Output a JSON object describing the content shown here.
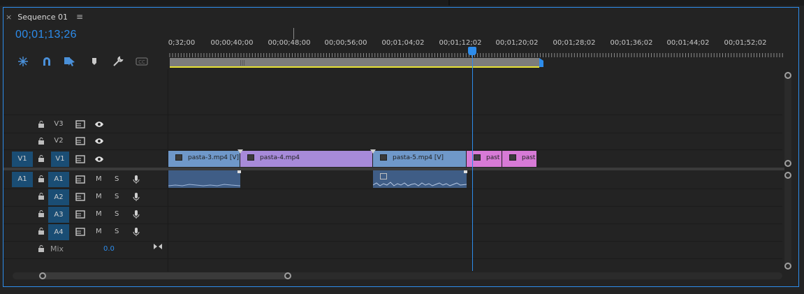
{
  "tab": {
    "title": "Sequence 01"
  },
  "timecode": "00;01;13;26",
  "ruler_labels": [
    "0;32;00",
    "00;00;40;00",
    "00;00;48;00",
    "00;00;56;00",
    "00;01;04;02",
    "00;01;12;02",
    "00;01;20;02",
    "00;01;28;02",
    "00;01;36;02",
    "00;01;44;02",
    "00;01;52;02"
  ],
  "toolbar": [
    "insert-snap-icon",
    "magnet-icon",
    "linked-selection-icon",
    "marker-icon",
    "wrench-icon",
    "captions-icon"
  ],
  "video_tracks": [
    {
      "name": "V3"
    },
    {
      "name": "V2"
    },
    {
      "name": "V1",
      "source": "V1"
    }
  ],
  "audio_tracks": [
    {
      "name": "A1",
      "source": "A1",
      "m": "M",
      "s": "S"
    },
    {
      "name": "A2",
      "m": "M",
      "s": "S"
    },
    {
      "name": "A3",
      "m": "M",
      "s": "S"
    },
    {
      "name": "A4",
      "m": "M",
      "s": "S"
    }
  ],
  "mix": {
    "label": "Mix",
    "value": "0.0"
  },
  "clips": [
    {
      "label": "pasta-3.mp4 [V]",
      "color": "#6f98c9"
    },
    {
      "label": "pasta-4.mp4",
      "color": "#a78ad9"
    },
    {
      "label": "pasta-5.mp4 [V]",
      "color": "#6f98c9"
    },
    {
      "label": "past",
      "color": "#d77ad6"
    },
    {
      "label": "past",
      "color": "#d77ad6"
    }
  ],
  "colors": {
    "accent": "#2d8ceb",
    "workarea": "#e9e335"
  }
}
